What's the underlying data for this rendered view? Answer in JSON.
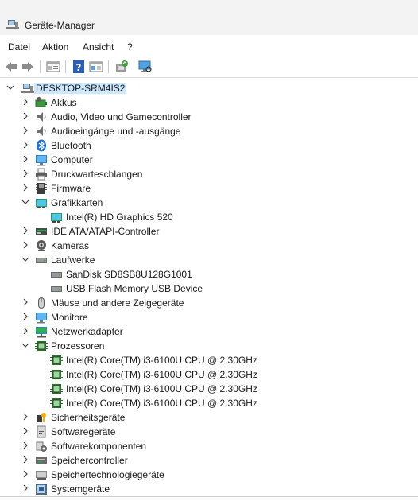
{
  "window": {
    "title": "Geräte-Manager"
  },
  "menu": [
    "Datei",
    "Aktion",
    "Ansicht",
    "?"
  ],
  "toolbar": [
    {
      "name": "back-icon"
    },
    {
      "name": "forward-icon"
    },
    {
      "name": "properties-icon"
    },
    {
      "name": "help-icon"
    },
    {
      "name": "view-icon"
    },
    {
      "name": "update-driver-icon"
    },
    {
      "name": "scan-hardware-icon"
    }
  ],
  "tree": [
    {
      "label": "DESKTOP-SRM4IS2",
      "level": 0,
      "state": "expanded",
      "icon": "computer-root-icon",
      "selected": true
    },
    {
      "label": "Akkus",
      "level": 1,
      "state": "collapsed",
      "icon": "battery-icon"
    },
    {
      "label": "Audio, Video und Gamecontroller",
      "level": 1,
      "state": "collapsed",
      "icon": "speaker-icon"
    },
    {
      "label": "Audioeingänge und -ausgänge",
      "level": 1,
      "state": "collapsed",
      "icon": "speaker-icon"
    },
    {
      "label": "Bluetooth",
      "level": 1,
      "state": "collapsed",
      "icon": "bluetooth-icon"
    },
    {
      "label": "Computer",
      "level": 1,
      "state": "collapsed",
      "icon": "monitor-icon"
    },
    {
      "label": "Druckwarteschlangen",
      "level": 1,
      "state": "collapsed",
      "icon": "printer-icon"
    },
    {
      "label": "Firmware",
      "level": 1,
      "state": "collapsed",
      "icon": "firmware-icon"
    },
    {
      "label": "Grafikkarten",
      "level": 1,
      "state": "expanded",
      "icon": "display-adapter-icon"
    },
    {
      "label": "Intel(R) HD Graphics 520",
      "level": 2,
      "state": "leaf",
      "icon": "display-adapter-icon"
    },
    {
      "label": "IDE ATA/ATAPI-Controller",
      "level": 1,
      "state": "collapsed",
      "icon": "ide-icon"
    },
    {
      "label": "Kameras",
      "level": 1,
      "state": "collapsed",
      "icon": "camera-icon"
    },
    {
      "label": "Laufwerke",
      "level": 1,
      "state": "expanded",
      "icon": "drive-icon"
    },
    {
      "label": "SanDisk SD8SB8U128G1001",
      "level": 2,
      "state": "leaf",
      "icon": "drive-icon"
    },
    {
      "label": "USB Flash Memory USB Device",
      "level": 2,
      "state": "leaf",
      "icon": "drive-icon"
    },
    {
      "label": "Mäuse und andere Zeigegeräte",
      "level": 1,
      "state": "collapsed",
      "icon": "mouse-icon"
    },
    {
      "label": "Monitore",
      "level": 1,
      "state": "collapsed",
      "icon": "monitor-icon"
    },
    {
      "label": "Netzwerkadapter",
      "level": 1,
      "state": "collapsed",
      "icon": "network-icon"
    },
    {
      "label": "Prozessoren",
      "level": 1,
      "state": "expanded",
      "icon": "cpu-icon"
    },
    {
      "label": "Intel(R) Core(TM) i3-6100U CPU @ 2.30GHz",
      "level": 2,
      "state": "leaf",
      "icon": "cpu-icon"
    },
    {
      "label": "Intel(R) Core(TM) i3-6100U CPU @ 2.30GHz",
      "level": 2,
      "state": "leaf",
      "icon": "cpu-icon"
    },
    {
      "label": "Intel(R) Core(TM) i3-6100U CPU @ 2.30GHz",
      "level": 2,
      "state": "leaf",
      "icon": "cpu-icon"
    },
    {
      "label": "Intel(R) Core(TM) i3-6100U CPU @ 2.30GHz",
      "level": 2,
      "state": "leaf",
      "icon": "cpu-icon"
    },
    {
      "label": "Sicherheitsgeräte",
      "level": 1,
      "state": "collapsed",
      "icon": "security-key-icon"
    },
    {
      "label": "Softwaregeräte",
      "level": 1,
      "state": "collapsed",
      "icon": "software-device-icon"
    },
    {
      "label": "Softwarekomponenten",
      "level": 1,
      "state": "collapsed",
      "icon": "software-component-icon"
    },
    {
      "label": "Speichercontroller",
      "level": 1,
      "state": "collapsed",
      "icon": "storage-controller-icon"
    },
    {
      "label": "Speichertechnologiegeräte",
      "level": 1,
      "state": "collapsed",
      "icon": "memory-tech-icon"
    },
    {
      "label": "Systemgeräte",
      "level": 1,
      "state": "collapsed",
      "icon": "system-device-icon"
    }
  ]
}
